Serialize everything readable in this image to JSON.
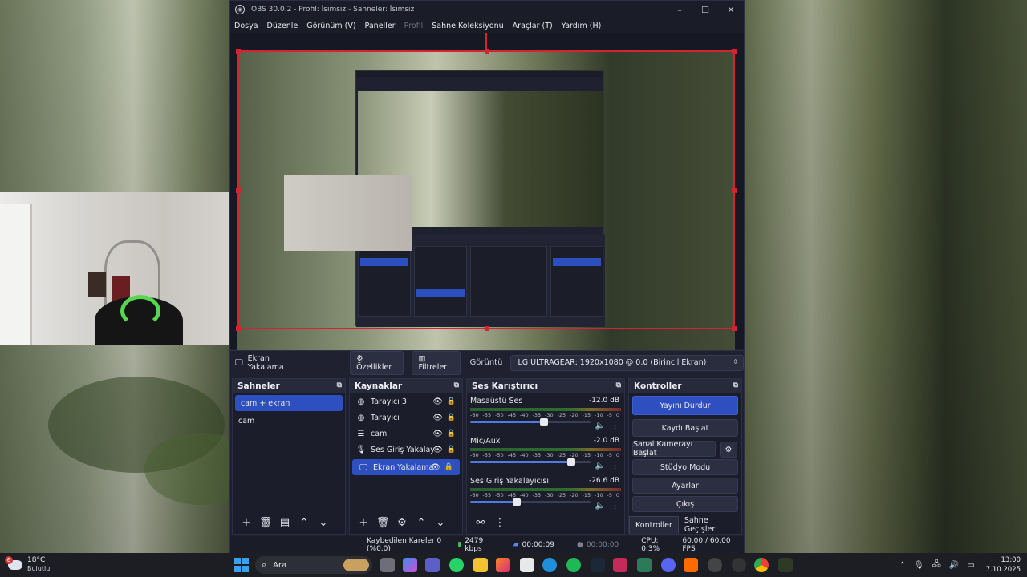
{
  "window": {
    "title": "OBS 30.0.2 - Profil: İsimsiz - Sahneler: İsimsiz",
    "controls": [
      "–",
      "☐",
      "✕"
    ]
  },
  "menu": [
    "Dosya",
    "Düzenle",
    "Görünüm (V)",
    "Paneller",
    "Profil",
    "Sahne Koleksiyonu",
    "Araçlar (T)",
    "Yardım (H)"
  ],
  "context_bar": {
    "source_name": "Ekran Yakalama",
    "properties": "Özellikler",
    "filters": "Filtreler",
    "display_label": "Görüntü",
    "display_value": "LG ULTRAGEAR: 1920x1080 @ 0,0 (Birincil Ekran)"
  },
  "scenes": {
    "title": "Sahneler",
    "items": [
      {
        "name": "cam + ekran",
        "active": true
      },
      {
        "name": "cam",
        "active": false
      }
    ]
  },
  "sources": {
    "title": "Kaynaklar",
    "items": [
      {
        "name": "Tarayıcı 3",
        "icon": "globe-icon",
        "active": false
      },
      {
        "name": "Tarayıcı",
        "icon": "globe-icon",
        "active": false
      },
      {
        "name": "cam",
        "icon": "list-icon",
        "active": false
      },
      {
        "name": "Ses Giriş Yakalayıcısı",
        "icon": "mic-icon",
        "active": false
      },
      {
        "name": "Ekran Yakalama",
        "icon": "monitor-icon",
        "active": true
      }
    ]
  },
  "mixer": {
    "title": "Ses Karıştırıcı",
    "ticks": [
      "-60",
      "-55",
      "-50",
      "-45",
      "-40",
      "-35",
      "-30",
      "-25",
      "-20",
      "-15",
      "-10",
      "-5",
      "0"
    ],
    "channels": [
      {
        "name": "Masaüstü Ses",
        "db": "-12.0 dB",
        "level": 0.61
      },
      {
        "name": "Mic/Aux",
        "db": "-2.0 dB",
        "level": 0.84
      },
      {
        "name": "Ses Giriş Yakalayıcısı",
        "db": "-26.6 dB",
        "level": 0.39
      }
    ]
  },
  "controls": {
    "title": "Kontroller",
    "stop_stream": "Yayını Durdur",
    "start_record": "Kaydı Başlat",
    "virtual_cam": "Sanal Kamerayı Başlat",
    "studio_mode": "Stüdyo Modu",
    "settings": "Ayarlar",
    "exit": "Çıkış",
    "tab_controls": "Kontroller",
    "tab_transitions": "Sahne Geçişleri"
  },
  "status": {
    "dropped": "Kaybedilen Kareler 0 (%0.0)",
    "bitrate": "2479 kbps",
    "stream_time": "00:00:09",
    "record_time": "00:00:00",
    "cpu": "CPU: 0.3%",
    "fps": "60.00 / 60.00 FPS"
  },
  "taskbar": {
    "weather_temp": "18°C",
    "weather_desc": "Bulutlu",
    "weather_badge": "6",
    "search_placeholder": "Ara",
    "time": "13:00",
    "date": "7.10.2025"
  },
  "colors": {
    "accent": "#2e4fbf",
    "selection": "#d3242f",
    "panel_bg": "#1b1d2a"
  }
}
